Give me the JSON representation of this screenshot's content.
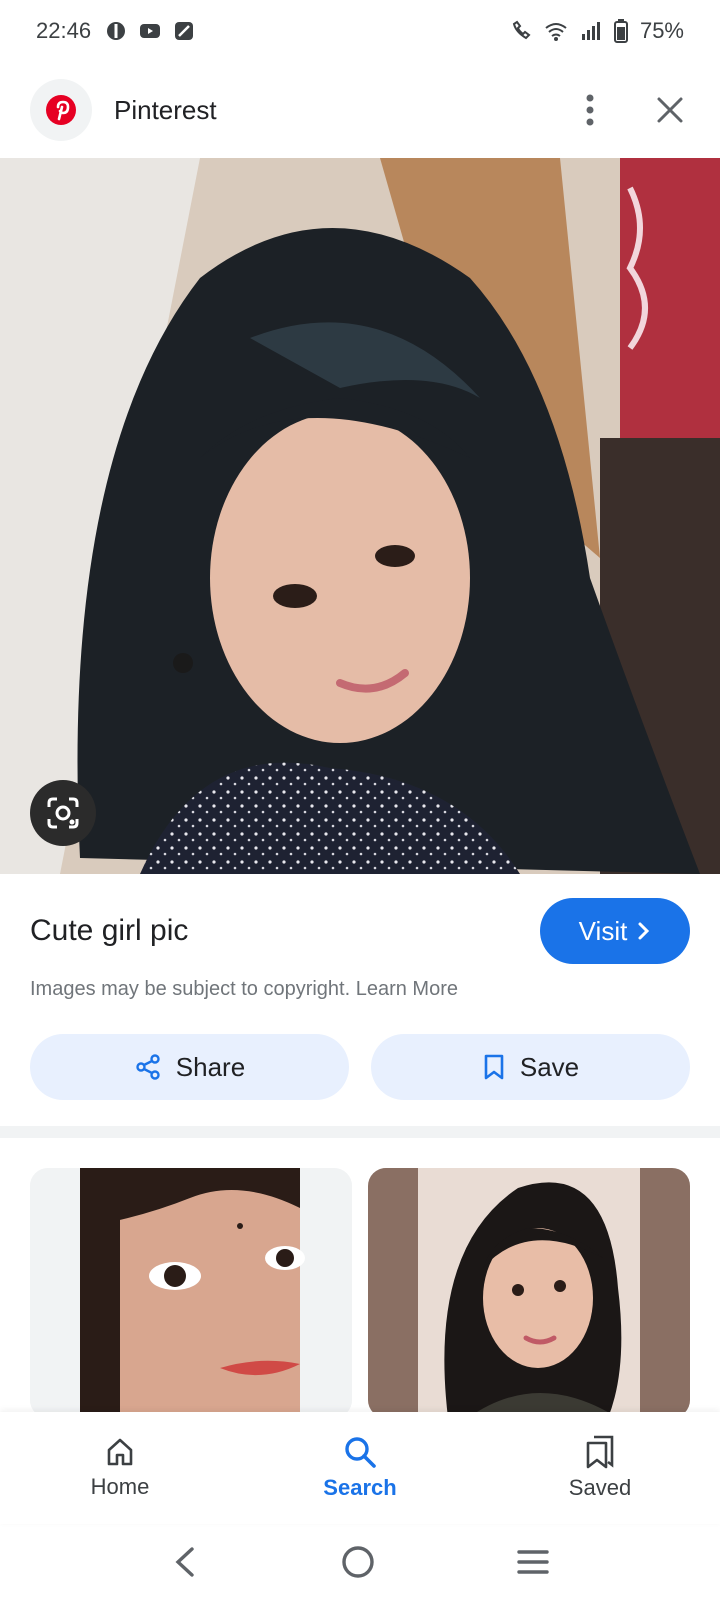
{
  "status_bar": {
    "time": "22:46",
    "battery": "75%"
  },
  "header": {
    "title": "Pinterest"
  },
  "result": {
    "title": "Cute girl pic",
    "visit_label": "Visit",
    "copyright_text": "Images may be subject to copyright. Learn More",
    "share_label": "Share",
    "save_label": "Save"
  },
  "bottom_nav": {
    "items": [
      {
        "label": "Home",
        "icon": "home-icon"
      },
      {
        "label": "Search",
        "icon": "search-icon",
        "active": true
      },
      {
        "label": "Saved",
        "icon": "saved-icon"
      }
    ]
  },
  "colors": {
    "accent": "#1a73e8",
    "chip_bg": "#e8f0fe",
    "pinterest_red": "#e60023"
  }
}
